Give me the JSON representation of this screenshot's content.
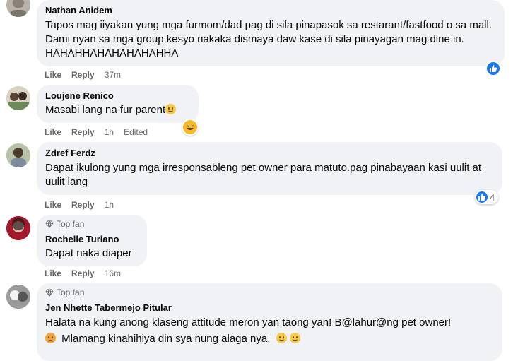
{
  "comments": [
    {
      "author": "Nathan Anidem",
      "text": "Tapos mag iiyakan yung mga furmom/dad pag di sila pinapasok sa restarant/fastfood o sa mall. Dami nyan sa mga group kesyo nakaka dismaya daw kase di sila pinayagan mag dine in. HAHAHHAHAHAHAHAHHA",
      "like": "Like",
      "reply": "Reply",
      "time": "37m"
    },
    {
      "author": "Loujene Renico",
      "text": "Masabi lang na fur parent",
      "like": "Like",
      "reply": "Reply",
      "time": "1h",
      "edited": "Edited"
    },
    {
      "author": "Zdref Ferdz",
      "text": "Dapat ikulong yung mga irresponsableng pet owner para matuto.pag pinabayaan kasi uulit at uulit lang",
      "like": "Like",
      "reply": "Reply",
      "time": "1h",
      "reaction_count": "4"
    },
    {
      "badge": "Top fan",
      "author": "Rochelle Turiano",
      "text": "Dapat naka diaper",
      "like": "Like",
      "reply": "Reply",
      "time": "16m"
    },
    {
      "badge": "Top fan",
      "author": "Jen Nhette Tabermejo Pitular",
      "text1": "Halata na kung anong klaseng attitude meron yan taong yan! B@lahur@ng pet owner!",
      "text2": "Mlamang kinahihiya din sya nung alaga nya."
    }
  ],
  "icons": {
    "like_reaction": "like-thumb-icon",
    "emoji": "grin-emoji-icon",
    "badge": "diamond-icon"
  },
  "colors": {
    "bubble": "#f0f2f5",
    "like_blue": "#1877f2",
    "meta_gray": "#65676b"
  }
}
